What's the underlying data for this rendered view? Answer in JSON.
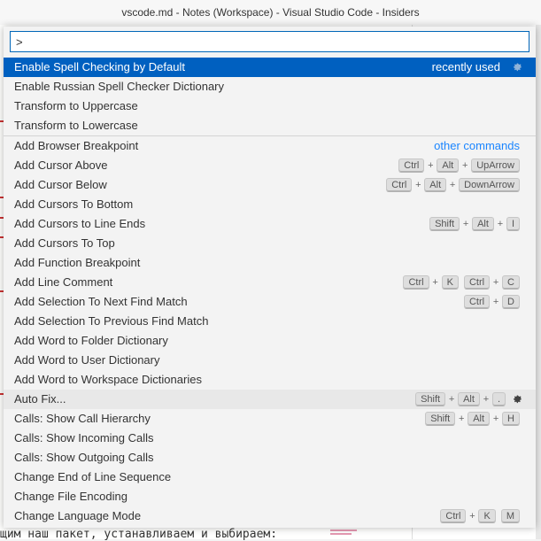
{
  "window": {
    "title": "vscode.md - Notes (Workspace) - Visual Studio Code - Insiders"
  },
  "palette": {
    "input_value": ">",
    "items": [
      {
        "label": "Enable Spell Checking by Default",
        "tag": "recently used",
        "gear": true,
        "selected": true,
        "keys": []
      },
      {
        "label": "Enable Russian Spell Checker Dictionary",
        "keys": []
      },
      {
        "label": "Transform to Uppercase",
        "keys": []
      },
      {
        "label": "Transform to Lowercase",
        "keys": []
      },
      {
        "label": "Add Browser Breakpoint",
        "other": "other commands",
        "sep": true,
        "keys": []
      },
      {
        "label": "Add Cursor Above",
        "keys": [
          [
            "Ctrl",
            "Alt",
            "UpArrow"
          ]
        ]
      },
      {
        "label": "Add Cursor Below",
        "keys": [
          [
            "Ctrl",
            "Alt",
            "DownArrow"
          ]
        ]
      },
      {
        "label": "Add Cursors To Bottom",
        "keys": []
      },
      {
        "label": "Add Cursors to Line Ends",
        "keys": [
          [
            "Shift",
            "Alt",
            "I"
          ]
        ]
      },
      {
        "label": "Add Cursors To Top",
        "keys": []
      },
      {
        "label": "Add Function Breakpoint",
        "keys": []
      },
      {
        "label": "Add Line Comment",
        "keys": [
          [
            "Ctrl",
            "K"
          ],
          [
            "Ctrl",
            "C"
          ]
        ]
      },
      {
        "label": "Add Selection To Next Find Match",
        "keys": [
          [
            "Ctrl",
            "D"
          ]
        ]
      },
      {
        "label": "Add Selection To Previous Find Match",
        "keys": []
      },
      {
        "label": "Add Word to Folder Dictionary",
        "keys": []
      },
      {
        "label": "Add Word to User Dictionary",
        "keys": []
      },
      {
        "label": "Add Word to Workspace Dictionaries",
        "keys": []
      },
      {
        "label": "Auto Fix...",
        "hover": true,
        "gear": true,
        "keys": [
          [
            "Shift",
            "Alt",
            "."
          ]
        ]
      },
      {
        "label": "Calls: Show Call Hierarchy",
        "keys": [
          [
            "Shift",
            "Alt",
            "H"
          ]
        ]
      },
      {
        "label": "Calls: Show Incoming Calls",
        "keys": []
      },
      {
        "label": "Calls: Show Outgoing Calls",
        "keys": []
      },
      {
        "label": "Change End of Line Sequence",
        "keys": []
      },
      {
        "label": "Change File Encoding",
        "keys": []
      },
      {
        "label": "Change Language Mode",
        "keys": [
          [
            "Ctrl",
            "K"
          ],
          [
            "M"
          ]
        ]
      }
    ]
  },
  "editor": {
    "bottom_line": "щим наш пакет, устанавливаем и выбираем:"
  },
  "colors": {
    "selection": "#0060c0",
    "focus_border": "#0066b8",
    "link": "#1a85ff"
  }
}
